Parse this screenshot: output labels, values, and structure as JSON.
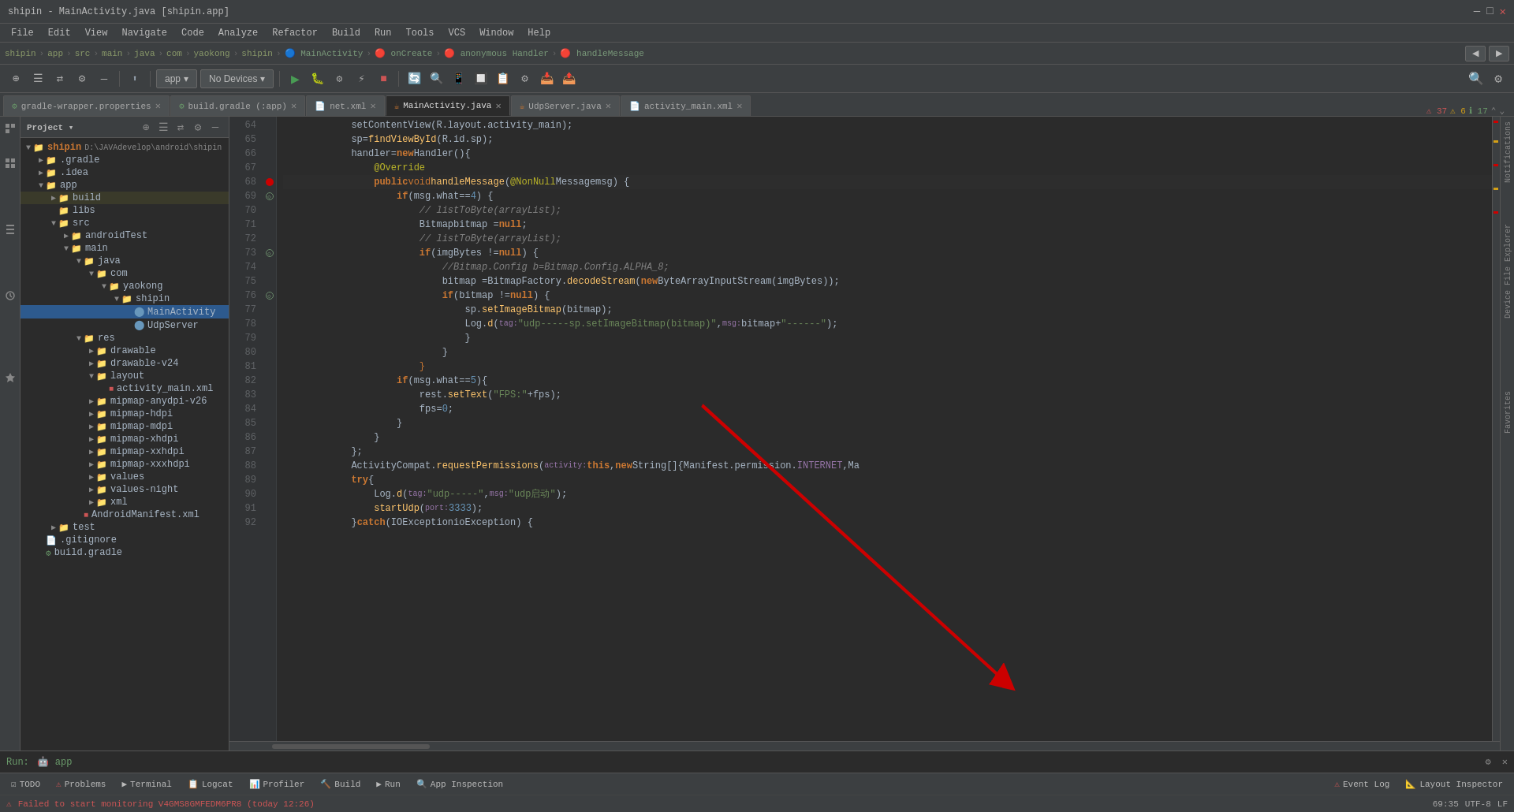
{
  "window": {
    "title": "shipin - MainActivity.java [shipin.app]",
    "controls": [
      "—",
      "□",
      "✕"
    ]
  },
  "menu": {
    "items": [
      "File",
      "Edit",
      "View",
      "Navigate",
      "Code",
      "Analyze",
      "Refactor",
      "Build",
      "Run",
      "Tools",
      "VCS",
      "Window",
      "Help"
    ]
  },
  "breadcrumb": {
    "items": [
      "shipin",
      "app",
      "src",
      "main",
      "java",
      "com",
      "yaokong",
      "shipin",
      "MainActivity",
      "onCreate",
      "anonymous Handler",
      "handleMessage"
    ]
  },
  "toolbar": {
    "app_label": "app",
    "no_devices_label": "No Devices",
    "run_label": "▶",
    "debug_label": "🐛"
  },
  "tabs": [
    {
      "name": "gradle-wrapper.properties",
      "active": false,
      "icon": "⚙"
    },
    {
      "name": "build.gradle (:app)",
      "active": false,
      "icon": "⚙"
    },
    {
      "name": "net.xml",
      "active": false,
      "icon": "📄"
    },
    {
      "name": "MainActivity.java",
      "active": true,
      "icon": "☕"
    },
    {
      "name": "UdpServer.java",
      "active": false,
      "icon": "☕"
    },
    {
      "name": "activity_main.xml",
      "active": false,
      "icon": "📄"
    }
  ],
  "error_indicators": {
    "errors": "37",
    "warnings": "6",
    "infos": "17"
  },
  "project": {
    "title": "Project",
    "root": {
      "name": "shipin",
      "path": "D:\\JAVAdevelop\\android\\shipin",
      "children": [
        {
          "name": ".gradle",
          "type": "folder",
          "expanded": false
        },
        {
          "name": ".idea",
          "type": "folder",
          "expanded": false
        },
        {
          "name": "app",
          "type": "folder",
          "expanded": true,
          "selected": false,
          "children": [
            {
              "name": "build",
              "type": "folder",
              "expanded": false,
              "highlight": true
            },
            {
              "name": "libs",
              "type": "folder",
              "expanded": false
            },
            {
              "name": "src",
              "type": "folder",
              "expanded": true,
              "children": [
                {
                  "name": "androidTest",
                  "type": "folder",
                  "expanded": false
                },
                {
                  "name": "main",
                  "type": "folder",
                  "expanded": true,
                  "children": [
                    {
                      "name": "java",
                      "type": "folder",
                      "expanded": true,
                      "children": [
                        {
                          "name": "com",
                          "type": "folder",
                          "expanded": true,
                          "children": [
                            {
                              "name": "yaokong",
                              "type": "folder",
                              "expanded": true,
                              "children": [
                                {
                                  "name": "shipin",
                                  "type": "folder",
                                  "expanded": true,
                                  "children": [
                                    {
                                      "name": "MainActivity",
                                      "type": "java"
                                    },
                                    {
                                      "name": "UdpServer",
                                      "type": "java"
                                    }
                                  ]
                                }
                              ]
                            }
                          ]
                        }
                      ]
                    },
                    {
                      "name": "res",
                      "type": "folder",
                      "expanded": true,
                      "children": [
                        {
                          "name": "drawable",
                          "type": "folder",
                          "expanded": false
                        },
                        {
                          "name": "drawable-v24",
                          "type": "folder",
                          "expanded": false
                        },
                        {
                          "name": "layout",
                          "type": "folder",
                          "expanded": true,
                          "children": [
                            {
                              "name": "activity_main.xml",
                              "type": "xml"
                            }
                          ]
                        },
                        {
                          "name": "mipmap-anydpi-v26",
                          "type": "folder",
                          "expanded": false
                        },
                        {
                          "name": "mipmap-hdpi",
                          "type": "folder",
                          "expanded": false
                        },
                        {
                          "name": "mipmap-mdpi",
                          "type": "folder",
                          "expanded": false
                        },
                        {
                          "name": "mipmap-xhdpi",
                          "type": "folder",
                          "expanded": false
                        },
                        {
                          "name": "mipmap-xxhdpi",
                          "type": "folder",
                          "expanded": false
                        },
                        {
                          "name": "mipmap-xxxhdpi",
                          "type": "folder",
                          "expanded": false
                        },
                        {
                          "name": "values",
                          "type": "folder",
                          "expanded": false
                        },
                        {
                          "name": "values-night",
                          "type": "folder",
                          "expanded": false
                        },
                        {
                          "name": "xml",
                          "type": "folder",
                          "expanded": false
                        }
                      ]
                    },
                    {
                      "name": "AndroidManifest.xml",
                      "type": "xml"
                    }
                  ]
                }
              ]
            }
          ]
        },
        {
          "name": "test",
          "type": "folder",
          "expanded": false
        },
        {
          "name": ".gitignore",
          "type": "file"
        },
        {
          "name": "build.gradle",
          "type": "gradle"
        }
      ]
    }
  },
  "code_lines": [
    {
      "num": 64,
      "content": "            setContentView(R.layout.activity_main);",
      "gutter": ""
    },
    {
      "num": 65,
      "content": "            sp=findViewById(R.id.sp);",
      "gutter": ""
    },
    {
      "num": 66,
      "content": "            handler=new Handler(){",
      "gutter": ""
    },
    {
      "num": 67,
      "content": "                @Override",
      "gutter": ""
    },
    {
      "num": 68,
      "content": "                public void handleMessage(@NonNull Message msg) {",
      "gutter": "bp",
      "bp": true
    },
    {
      "num": 69,
      "content": "                    if (msg.what==4) {",
      "gutter": "arrow"
    },
    {
      "num": 70,
      "content": "                        // listToByte(arrayList);",
      "gutter": ""
    },
    {
      "num": 71,
      "content": "                        Bitmap bitmap = null;",
      "gutter": ""
    },
    {
      "num": 72,
      "content": "                        // listToByte(arrayList);",
      "gutter": ""
    },
    {
      "num": 73,
      "content": "                        if (imgBytes != null) {",
      "gutter": "arrow"
    },
    {
      "num": 74,
      "content": "                            //Bitmap.Config b=Bitmap.Config.ALPHA_8;",
      "gutter": ""
    },
    {
      "num": 75,
      "content": "                            bitmap = BitmapFactory.decodeStream(new ByteArrayInputStream(imgBytes));",
      "gutter": ""
    },
    {
      "num": 76,
      "content": "                            if (bitmap != null) {",
      "gutter": "arrow"
    },
    {
      "num": 77,
      "content": "                                sp.setImageBitmap(bitmap);",
      "gutter": ""
    },
    {
      "num": 78,
      "content": "                                Log.d( tag: \"udp-----sp.setImageBitmap(bitmap)\", msg: bitmap+\"------\");",
      "gutter": ""
    },
    {
      "num": 79,
      "content": "                            }",
      "gutter": ""
    },
    {
      "num": 80,
      "content": "                        }",
      "gutter": ""
    },
    {
      "num": 81,
      "content": "                    }",
      "gutter": ""
    },
    {
      "num": 82,
      "content": "                    if (msg.what==5){",
      "gutter": ""
    },
    {
      "num": 83,
      "content": "                        rest.setText(\"FPS:\"+fps);",
      "gutter": ""
    },
    {
      "num": 84,
      "content": "                        fps=0;",
      "gutter": ""
    },
    {
      "num": 85,
      "content": "                    }",
      "gutter": ""
    },
    {
      "num": 86,
      "content": "                }",
      "gutter": ""
    },
    {
      "num": 87,
      "content": "            };",
      "gutter": ""
    },
    {
      "num": 88,
      "content": "            ActivityCompat.requestPermissions( activity: this,new String[]{Manifest.permission.INTERNET,Ma",
      "gutter": ""
    },
    {
      "num": 89,
      "content": "            try {",
      "gutter": ""
    },
    {
      "num": 90,
      "content": "                Log.d( tag: \"udp-----\", msg: \"udp启动\");",
      "gutter": ""
    },
    {
      "num": 91,
      "content": "                startUdp( port: 3333);",
      "gutter": ""
    },
    {
      "num": 92,
      "content": "            } catch (IOException ioException) {",
      "gutter": ""
    }
  ],
  "bottom_tabs": [
    {
      "label": "TODO",
      "icon": "☑",
      "badge": null
    },
    {
      "label": "Problems",
      "icon": "⚠",
      "badge": null
    },
    {
      "label": "Terminal",
      "icon": "▶",
      "badge": null
    },
    {
      "label": "Logcat",
      "icon": "📋",
      "badge": null
    },
    {
      "label": "Profiler",
      "icon": "📊",
      "badge": null
    },
    {
      "label": "Build",
      "icon": "🔨",
      "badge": null
    },
    {
      "label": "Run",
      "icon": "▶",
      "badge": null
    },
    {
      "label": "App Inspection",
      "icon": "🔍",
      "badge": null
    }
  ],
  "run_bar": {
    "label": "Run:",
    "app_label": "app"
  },
  "status_bar": {
    "message": "Failed to start monitoring V4GMS8GMFEDM6PR8 (today 12:26)",
    "position": "69:35",
    "event_log": "Event Log",
    "layout_inspector": "Layout Inspector"
  },
  "right_side_labels": [
    "Notifications",
    "Device File Explorer",
    "Favorites"
  ],
  "left_side_labels": [
    "Resource Manager",
    "Build Variants",
    "Structure"
  ]
}
